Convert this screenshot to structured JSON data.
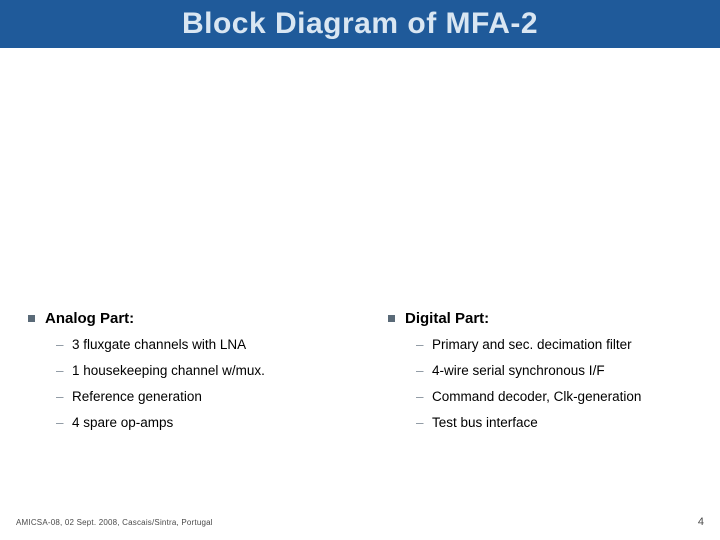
{
  "title": "Block Diagram of MFA-2",
  "columns": {
    "left": {
      "heading": "Analog Part:",
      "items": [
        "3 fluxgate channels with LNA",
        "1 housekeeping channel w/mux.",
        "Reference generation",
        "4 spare op-amps"
      ]
    },
    "right": {
      "heading": "Digital Part:",
      "items": [
        "Primary and sec. decimation filter",
        "4-wire serial synchronous I/F",
        "Command decoder, Clk-generation",
        "Test bus interface"
      ]
    }
  },
  "footer": {
    "left": "AMICSA-08, 02 Sept. 2008, Cascais/Sintra, Portugal",
    "page": "4"
  }
}
